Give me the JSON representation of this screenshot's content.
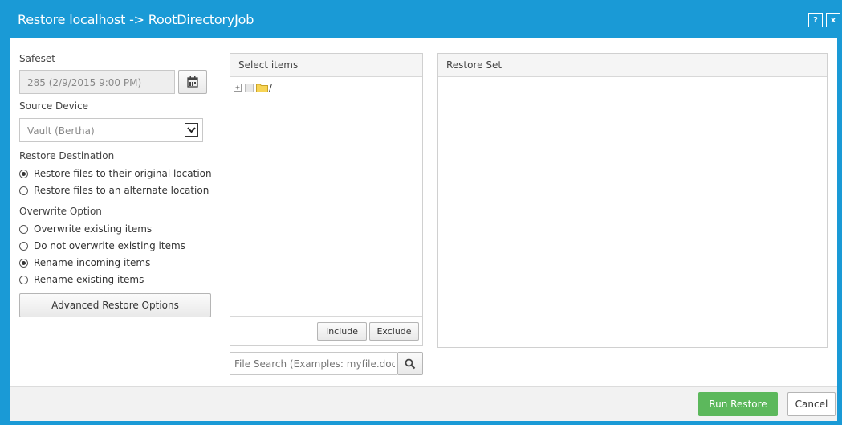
{
  "window": {
    "title": "Restore localhost -> RootDirectoryJob",
    "help_label": "?",
    "close_label": "x"
  },
  "safeset": {
    "label": "Safeset",
    "value": "285 (2/9/2015 9:00 PM)"
  },
  "source_device": {
    "label": "Source Device",
    "value": "Vault (Bertha)"
  },
  "restore_destination": {
    "label": "Restore Destination",
    "options": [
      "Restore files to their original location",
      "Restore files to an alternate location"
    ],
    "selected": 0
  },
  "overwrite_option": {
    "label": "Overwrite Option",
    "options": [
      "Overwrite existing items",
      "Do not overwrite existing items",
      "Rename incoming items",
      "Rename existing items"
    ],
    "selected": 2
  },
  "advanced_button": "Advanced Restore Options",
  "select_items": {
    "header": "Select items",
    "tree_root": "/",
    "include_label": "Include",
    "exclude_label": "Exclude"
  },
  "search": {
    "placeholder": "File Search (Examples: myfile.doc, *.doc)"
  },
  "restore_set": {
    "header": "Restore Set"
  },
  "footer": {
    "run_label": "Run Restore",
    "cancel_label": "Cancel"
  },
  "colors": {
    "titlebar": "#1a9ad6",
    "run_button": "#5cb85c"
  },
  "icons": [
    "calendar-icon",
    "chevron-down-icon",
    "expand-icon",
    "folder-icon",
    "search-icon"
  ]
}
